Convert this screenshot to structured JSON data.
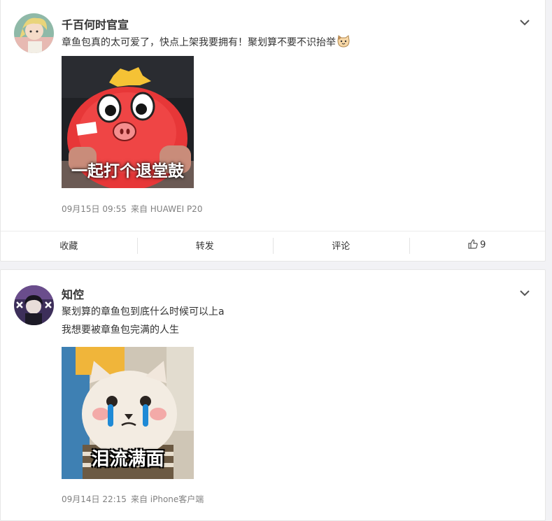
{
  "posts": [
    {
      "author": "千百何时官宣",
      "lines": [
        "章鱼包真的太可爱了，快点上架我要拥有！聚划算不要不识抬举"
      ],
      "image_caption": "一起打个退堂鼓",
      "date": "09月15日 09:55",
      "source_prefix": "来自",
      "source_name": "HUAWEI P20",
      "actions": {
        "favorite": "收藏",
        "repost": "转发",
        "comment": "评论",
        "likes": "9"
      }
    },
    {
      "author": "知倥",
      "lines": [
        "聚划算的章鱼包到底什么时候可以上a",
        "我想要被章鱼包完满的人生"
      ],
      "image_caption": "泪流满面",
      "date": "09月14日 22:15",
      "source_prefix": "来自",
      "source_name": "iPhone客户端"
    }
  ],
  "colors": {
    "page_bg": "#f2f2f5",
    "card_bg": "#ffffff",
    "meta_text": "#808080"
  }
}
